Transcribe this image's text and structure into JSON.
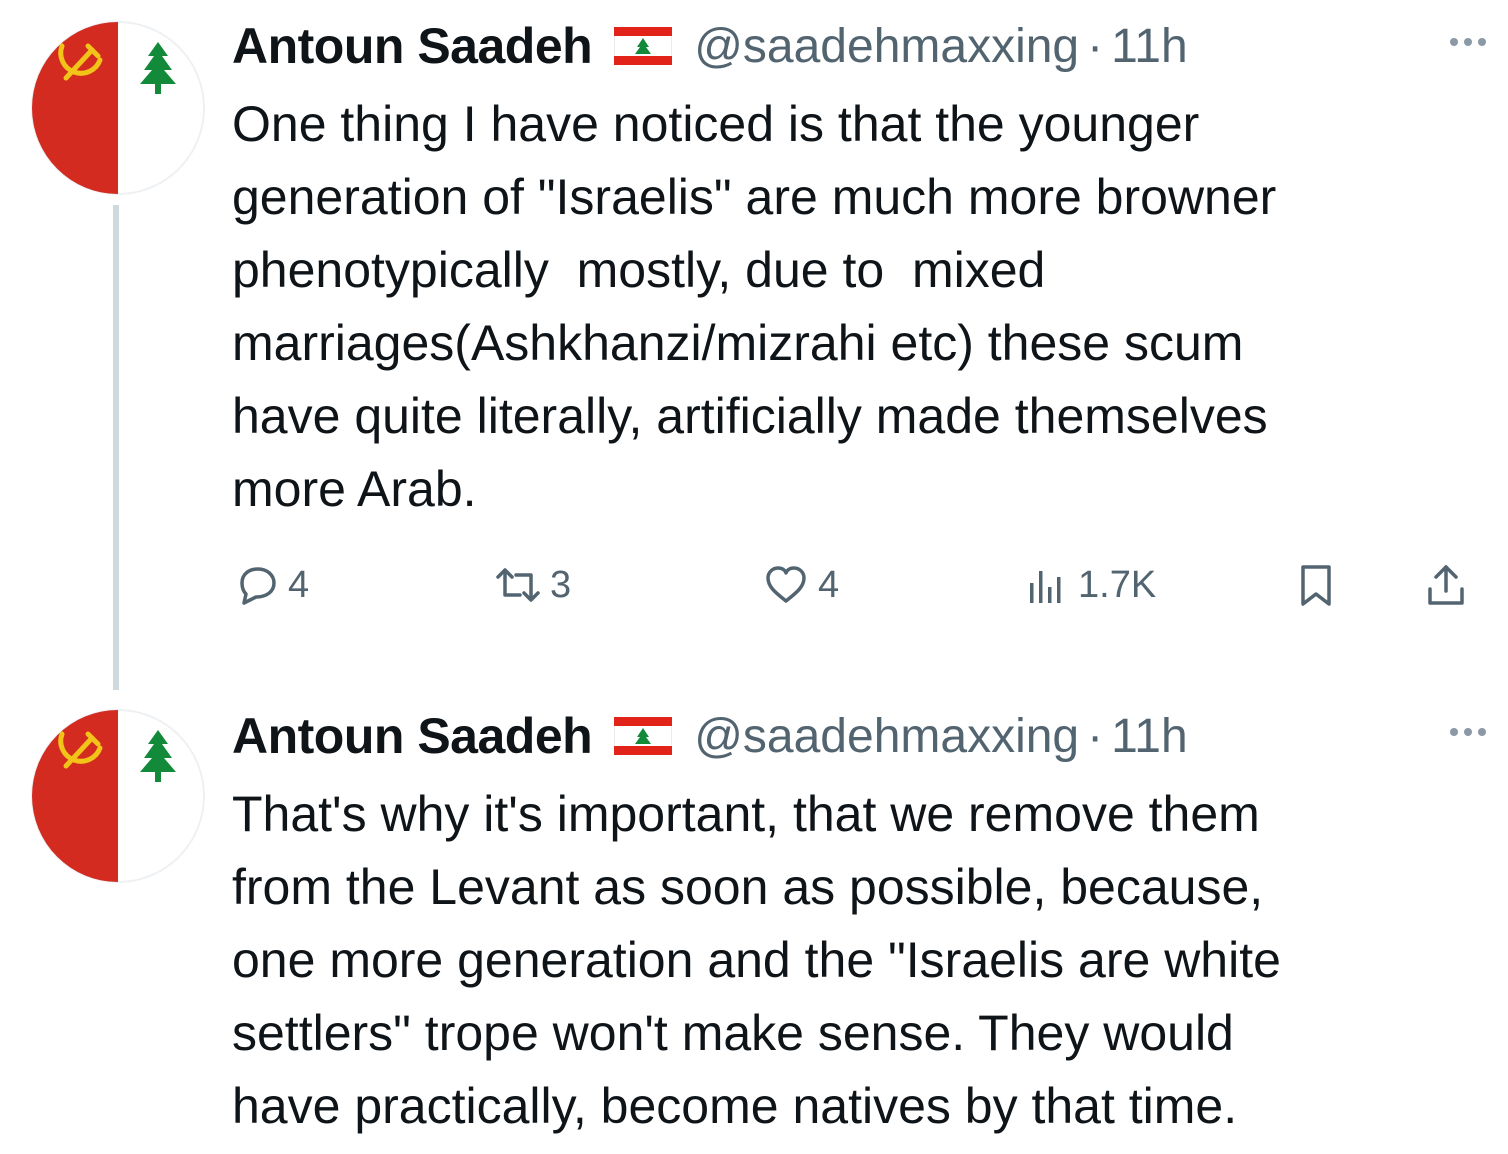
{
  "tweets": [
    {
      "author": {
        "name": "Antoun Saadeh",
        "handle": "@saadehmaxxing",
        "time": "11h",
        "separator": "·",
        "flag_icon": "lebanon-flag-icon"
      },
      "text": "One thing I have noticed is that the younger\ngeneration of \"Israelis\" are much more browner\nphenotypically  mostly, due to  mixed\nmarriages(Ashkhanzi/mizrahi etc) these scum\nhave quite literally, artificially made themselves\nmore Arab.",
      "actions": {
        "replies": "4",
        "retweets": "3",
        "likes": "4",
        "views": "1.7K"
      }
    },
    {
      "author": {
        "name": "Antoun Saadeh",
        "handle": "@saadehmaxxing",
        "time": "11h",
        "separator": "·",
        "flag_icon": "lebanon-flag-icon"
      },
      "text": "That's why it's important, that we remove them\nfrom the Levant as soon as possible, because,\none more generation and the \"Israelis are white\nsettlers\" trope won't make sense. They would\nhave practically, become natives by that time."
    }
  ],
  "colors": {
    "avatar_red": "#d32b20",
    "cedar_green": "#138a3a",
    "muted_text": "#536471",
    "thread_line": "#cfd9de"
  }
}
